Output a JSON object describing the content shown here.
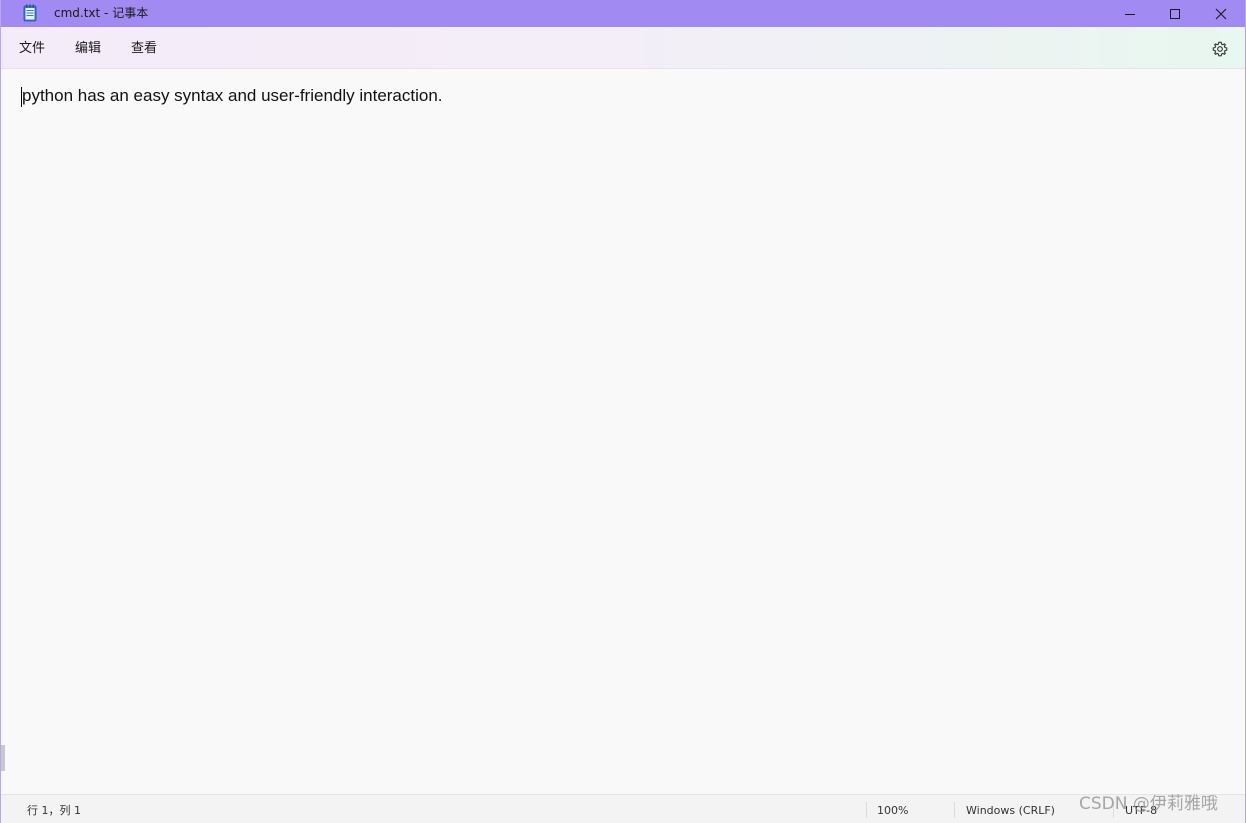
{
  "window": {
    "title": "cmd.txt - 记事本"
  },
  "menu": {
    "file": "文件",
    "edit": "编辑",
    "view": "查看"
  },
  "editor": {
    "content": "python has an easy syntax and user-friendly interaction."
  },
  "status": {
    "position": "行 1，列 1",
    "zoom": "100%",
    "line_ending": "Windows (CRLF)",
    "encoding": "UTF-8"
  },
  "watermark": {
    "text": "CSDN @伊莉雅哦"
  },
  "icons": {
    "app": "notepad-icon",
    "settings": "gear-icon",
    "minimize": "minimize-icon",
    "maximize": "maximize-icon",
    "close": "close-icon"
  },
  "colors": {
    "titlebar": "#a18af2",
    "window_border": "#b9a6f1",
    "editor_bg": "#f9f9f9"
  }
}
